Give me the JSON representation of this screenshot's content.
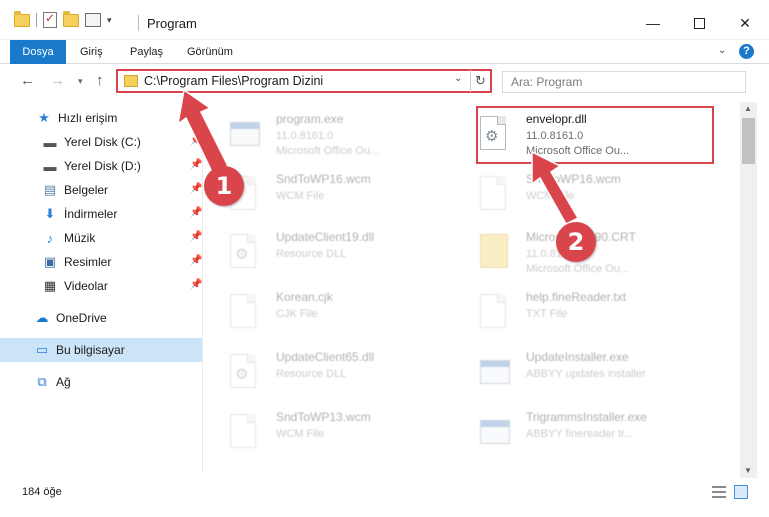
{
  "window": {
    "title": "Program",
    "minimize": "—",
    "close": "✕"
  },
  "ribbon": {
    "tabs": [
      "Dosya",
      "Giriş",
      "Paylaş",
      "Görünüm"
    ],
    "help": "?"
  },
  "address": {
    "path": "C:\\Program Files\\Program Dizini",
    "search_placeholder": "Ara: Program"
  },
  "sidebar": {
    "items": [
      {
        "label": "Hızlı erişim",
        "icon": "star-icon"
      },
      {
        "label": "Yerel Disk (C:)",
        "icon": "drive-icon",
        "pinned": true
      },
      {
        "label": "Yerel Disk (D:)",
        "icon": "drive-icon",
        "pinned": true
      },
      {
        "label": "Belgeler",
        "icon": "documents-icon",
        "pinned": true
      },
      {
        "label": "İndirmeler",
        "icon": "download-icon",
        "pinned": true
      },
      {
        "label": "Müzik",
        "icon": "music-icon",
        "pinned": true
      },
      {
        "label": "Resimler",
        "icon": "pictures-icon",
        "pinned": true
      },
      {
        "label": "Videolar",
        "icon": "videos-icon",
        "pinned": true
      },
      {
        "label": "OneDrive",
        "icon": "cloud-icon"
      },
      {
        "label": "Bu bilgisayar",
        "icon": "computer-icon",
        "selected": true
      },
      {
        "label": "Ağ",
        "icon": "network-icon"
      }
    ]
  },
  "files": [
    {
      "name": "program.exe",
      "line1": "11.0.8161.0",
      "line2": "Microsoft Office Ou...",
      "icon": "exe-icon"
    },
    {
      "name": "envelopr.dll",
      "line1": "11.0.8161.0",
      "line2": "Microsoft Office Ou...",
      "icon": "dll-icon"
    },
    {
      "name": "SndToWP16.wcm",
      "line1": "WCM File",
      "line2": "",
      "icon": "file-icon"
    },
    {
      "name": "SndToWP16.wcm",
      "line1": "WCM File",
      "line2": "",
      "icon": "file-icon"
    },
    {
      "name": "UpdateClient19.dll",
      "line1": "Resource DLL",
      "line2": "",
      "icon": "dll-icon"
    },
    {
      "name": "Microsoft.VC90.CRT",
      "line1": "11.0.8161.0",
      "line2": "Microsoft Office Ou...",
      "icon": "folder-icon"
    },
    {
      "name": "Korean.cjk",
      "line1": "CJK File",
      "line2": "",
      "icon": "file-icon"
    },
    {
      "name": "help.fineReader.txt",
      "line1": "TXT File",
      "line2": "",
      "icon": "file-icon"
    },
    {
      "name": "UpdateClient65.dll",
      "line1": "Resource DLL",
      "line2": "",
      "icon": "dll-icon"
    },
    {
      "name": "UpdateInstaller.exe",
      "line1": "ABBYY updates installer",
      "line2": "",
      "icon": "exe-icon"
    },
    {
      "name": "SndToWP13.wcm",
      "line1": "WCM File",
      "line2": "",
      "icon": "file-icon"
    },
    {
      "name": "TrigrammsInstaller.exe",
      "line1": "ABBYY finereader tr...",
      "line2": "",
      "icon": "exe-icon"
    }
  ],
  "status": {
    "item_count": "184 öğe"
  },
  "annotations": {
    "badge1": "1",
    "badge2": "2"
  },
  "colors": {
    "accent": "#1979ca",
    "highlight": "#d9454a",
    "selected": "#cce4f7"
  }
}
